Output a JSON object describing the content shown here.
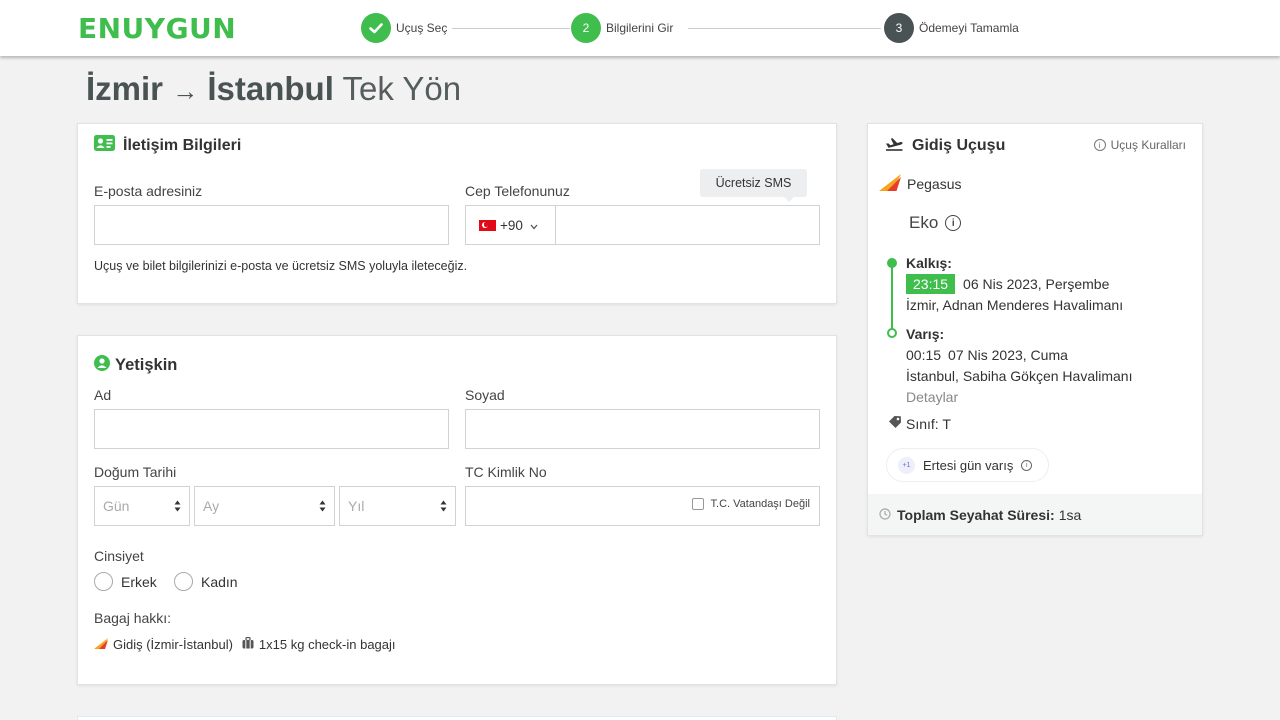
{
  "header": {
    "logo": "ENUYGUN",
    "steps": [
      {
        "number": "",
        "label": "Uçuş Seç"
      },
      {
        "number": "2",
        "label": "Bilgilerini Gir"
      },
      {
        "number": "3",
        "label": "Ödemeyi Tamamla"
      }
    ]
  },
  "route": {
    "from": "İzmir",
    "arrow": "→",
    "to": "İstanbul",
    "trip_type": "Tek Yön"
  },
  "contact": {
    "title": "İletişim Bilgileri",
    "email_label": "E-posta adresiniz",
    "email_value": "",
    "phone_label": "Cep Telefonunuz",
    "sms_tooltip": "Ücretsiz SMS",
    "country_code": "+90",
    "phone_value": "",
    "note": "Uçuş ve bilet bilgilerinizi e-posta ve ücretsiz SMS yoluyla ileteceğiz."
  },
  "passenger": {
    "title": "Yetişkin",
    "first_name_label": "Ad",
    "last_name_label": "Soyad",
    "dob_label": "Doğum Tarihi",
    "day_placeholder": "Gün",
    "month_placeholder": "Ay",
    "year_placeholder": "Yıl",
    "tc_label": "TC Kimlik No",
    "tc_checkbox_label": "T.C. Vatandaşı Değil",
    "gender_label": "Cinsiyet",
    "gender_options": [
      "Erkek",
      "Kadın"
    ],
    "baggage_label": "Bagaj hakkı:",
    "baggage_route": "Gidiş (İzmir-İstanbul)",
    "baggage_allowance": "1x15 kg check-in bagajı"
  },
  "flight": {
    "title": "Gidiş Uçuşu",
    "rules_link": "Uçuş Kuralları",
    "airline": "Pegasus",
    "fare": "Eko",
    "departure_label": "Kalkış:",
    "departure_time": "23:15",
    "departure_date": "06 Nis 2023, Perşembe",
    "departure_airport": "İzmir, Adnan Menderes Havalimanı",
    "arrival_label": "Varış:",
    "arrival_time": "00:15",
    "arrival_date": "07 Nis 2023, Cuma",
    "arrival_airport": "İstanbul, Sabiha Gökçen Havalimanı",
    "details_link": "Detaylar",
    "class_label": "Sınıf: T",
    "next_day_badge": "+1",
    "next_day_label": "Ertesi gün varış",
    "total_label": "Toplam Seyahat Süresi:",
    "total_value": "1sa"
  },
  "colors": {
    "brand_green": "#3fbe4e",
    "step_dark": "#4a5354"
  }
}
